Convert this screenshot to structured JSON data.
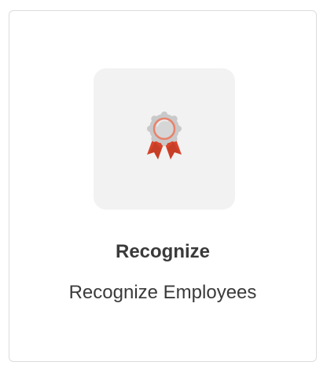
{
  "card": {
    "title": "Recognize",
    "subtitle": "Recognize Employees",
    "icon": "award-ribbon-icon"
  },
  "colors": {
    "tile_background": "#f2f2f2",
    "badge_gray": "#c9c9c9",
    "badge_inner": "#d6d6d6",
    "badge_ring": "#e8826c",
    "ribbon_red": "#d9442a",
    "ribbon_dark": "#a8321f",
    "text": "#3a3a3a"
  }
}
